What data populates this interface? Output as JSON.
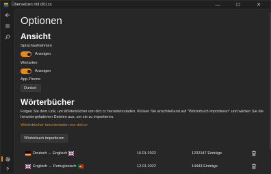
{
  "window": {
    "title": "Übersetzen mit dict.cc",
    "controls": {
      "minimize": "—",
      "maximize": "☐",
      "close": "✕"
    }
  },
  "rail": {
    "items": [
      {
        "icon": "back-arrow-icon",
        "glyph": "←"
      },
      {
        "icon": "hamburger-menu-icon",
        "glyph": "≡"
      },
      {
        "icon": "search-icon",
        "glyph": "⌕"
      },
      {
        "icon": "gear-icon",
        "glyph": "⚙"
      },
      {
        "icon": "help-icon",
        "glyph": "?"
      }
    ]
  },
  "page": {
    "title": "Optionen",
    "view": {
      "heading": "Ansicht",
      "voice_label": "Sprachaufnahmen",
      "voice_toggle": "Anzeigen",
      "wordtypes_label": "Wortarten",
      "wordtypes_toggle": "Anzeigen",
      "theme_label": "App-Theme",
      "theme_value": "Dunkel"
    },
    "dictionaries": {
      "heading": "Wörterbücher",
      "description": "Folgen Sie dem Link, um Wörterbücher von dict.cc herunterzuladen. Klicken Sie anschließend auf \"Wörterbuch importieren\" und wählen Sie die heruntergeladenen Dateien aus, um sie zu importieren.",
      "download_link": "Wörterbücher herunterladen von dict.cc",
      "import_button": "Wörterbuch importieren",
      "entries": [
        {
          "name": "Deutsch ↔ Englisch",
          "date": "16.01.2022",
          "count": "1232147 Einträge"
        },
        {
          "name": "Englisch ↔ Portugiesisch",
          "date": "12.01.2022",
          "count": "14443 Einträge"
        }
      ]
    }
  },
  "colors": {
    "accent": "#e8891c",
    "background": "#272727",
    "rail": "#202020"
  }
}
